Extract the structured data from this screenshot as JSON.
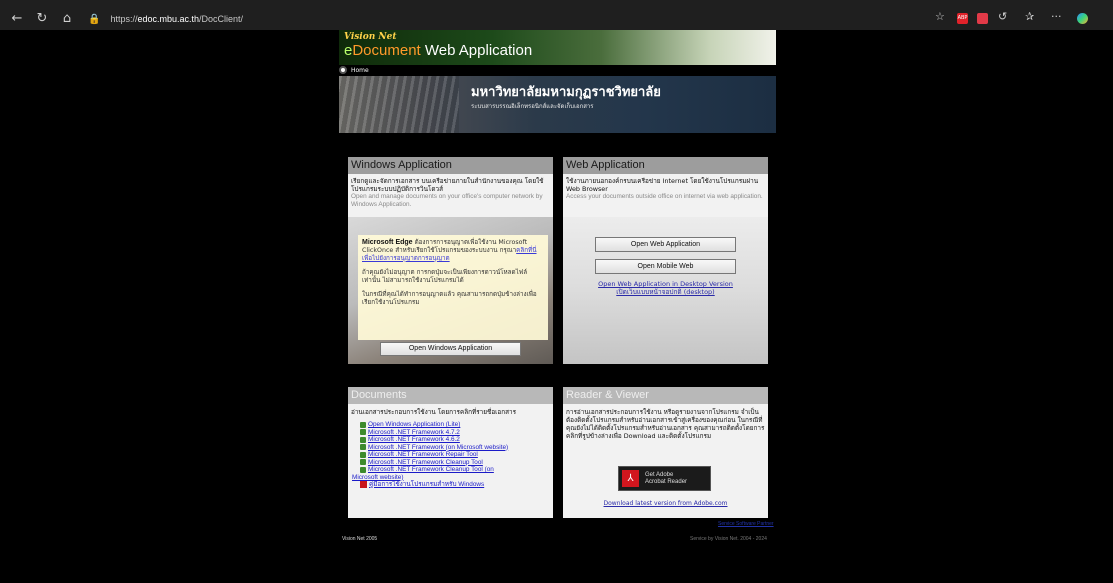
{
  "browser": {
    "url_prefix": "https://",
    "url_host": "edoc.mbu.ac.th",
    "url_path": "/DocClient/",
    "ext_badge": "ABP",
    "more": "···"
  },
  "banner": {
    "logo_text": "Vision Net",
    "title_e": "e",
    "title_doc": "Document",
    "title_rest": " Web Application"
  },
  "nav": {
    "home_label": "Home"
  },
  "header": {
    "university": "มหาวิทยาลัยมหามกุฏราชวิทยาลัย",
    "subtitle": "ระบบสารบรรณอิเล็กทรอนิกส์และจัดเก็บเอกสาร"
  },
  "windows_app": {
    "title": "Windows Application",
    "desc_th": "เรียกดูและจัดการเอกสาร บนเครือข่ายภายในสำนักงานของคุณ โดยใช้โปรแกรมระบบปฏิบัติการวินโดวส์",
    "desc_en": "Open and manage documents on your office's computer network by Windows Application.",
    "note_brand": "Microsoft Edge",
    "note_1": " ต้องการการอนุญาตเพื่อใช้งาน Microsoft ClickOnce สำหรับเรียกใช้โปรแกรมของระบบงาน กรุณา",
    "note_link": "คลิกที่นี่เพื่อไปยังการอนุญาตการอนุญาต",
    "note_2": "ถ้าคุณยังไม่อนุญาต การกดปุ่มจะเป็นเพียงการดาวน์โหลดไฟล์เท่านั้น ไม่สามารถใช้งานโปรแกรมได้",
    "note_3": "ในกรณีที่คุณได้ทำการอนุญาตแล้ว คุณสามารถกดปุ่มข้างล่างเพื่อเรียกใช้งานโปรแกรม",
    "button": "Open Windows Application"
  },
  "web_app": {
    "title": "Web Application",
    "desc_th": "ใช้งานภายนอกองค์กรบนเครือข่าย Internet โดยใช้งานโปรแกรมผ่าน Web Browser",
    "desc_en": "Access your documents outside office on internet via web application.",
    "button_web": "Open Web Application",
    "button_mobile": "Open Mobile Web",
    "desktop_link_1": "Open Web Application in Desktop Version",
    "desktop_link_2": "เปิดเว็บแบบหน้าจอปกติ (desktop)"
  },
  "documents": {
    "title": "Documents",
    "intro": "อ่านเอกสารประกอบการใช้งาน โดยการคลิกที่รายชื่อเอกสาร",
    "items": [
      "Open Windows Application (Lite)",
      "Microsoft .NET Framework 4.7.2",
      "Microsoft .NET Framework 4.6.2",
      "Microsoft .NET Framework (on Microsoft website)",
      "Microsoft .NET Framework Repair Tool",
      "Microsoft .NET Framework Cleanup Tool",
      "Microsoft .NET Framework Cleanup Tool (on",
      "Microsoft website)"
    ],
    "manual": "คู่มือการใช้งานโปรแกรมสำหรับ Windows"
  },
  "reader": {
    "title": "Reader & Viewer",
    "desc": "การอ่านเอกสารประกอบการใช้งาน หรือดูรายงานจากโปรแกรม จำเป็นต้องติดตั้งโปรแกรมสำหรับอ่านเอกสารเข้าสู่เครื่องของคุณก่อน ในกรณีที่คุณยังไม่ได้ติดตั้งโปรแกรมสำหรับอ่านเอกสาร คุณสามารถติดตั้งโดยการคลิกที่รูปข้างล่างเพื่อ Download และติดตั้งโปรแกรม",
    "adobe_line1": "Get Adobe",
    "adobe_line2": "Acrobat Reader",
    "download_link": "Download latest version from Adobe.com"
  },
  "footer": {
    "left": "Vision Net 2005",
    "right": "Service by Vision Net. 2004 - 2024",
    "link": "Service Software Partner"
  }
}
